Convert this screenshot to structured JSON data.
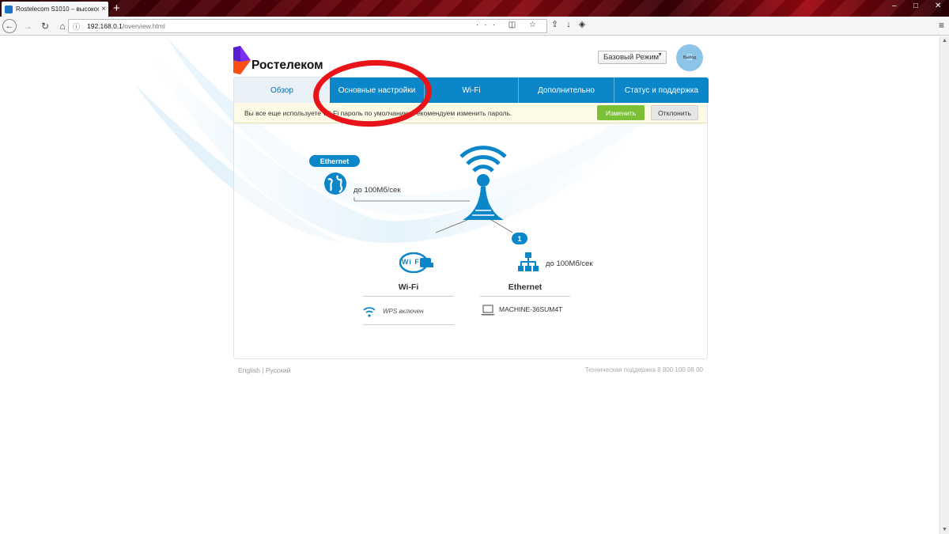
{
  "browser": {
    "tab_title": "Rostelecom S1010 – высокоск",
    "new_tab": "+",
    "url_host": "192.168.0.1",
    "url_path": "/overview.html",
    "window_controls": [
      "–",
      "□",
      "✕"
    ]
  },
  "header": {
    "logo_text": "Ростелеком",
    "mode_select": "Базовый Режим",
    "logout_label": "Выход"
  },
  "nav": {
    "tabs": [
      "Обзор",
      "Основные настройки",
      "Wi-Fi",
      "Дополнительно",
      "Статус и поддержка"
    ],
    "active_index": 0
  },
  "warning": {
    "text": "Вы все еще используете Wi-Fi пароль по умолчанию. Рекомендуем изменить пароль.",
    "change_label": "Изменить",
    "decline_label": "Отклонить"
  },
  "overview": {
    "wan_badge": "Ethernet",
    "wan_speed": "до 100Мб/сек",
    "client_count": "1",
    "wifi_logo": "Wi Fi",
    "wifi_title": "Wi-Fi",
    "wps_status": "WPS включен",
    "lan_speed": "до 100Мб/сек",
    "lan_title": "Ethernet",
    "lan_device": "MACHINE-36SUM4T"
  },
  "footer": {
    "lang_en": "English",
    "lang_sep": "|",
    "lang_ru": "Русский",
    "support": "Техническая поддержка 8 800 100 08 00"
  },
  "colors": {
    "brand_blue": "#0a86c9",
    "accept_green": "#7cc135",
    "annotation_red": "#e8141a"
  }
}
